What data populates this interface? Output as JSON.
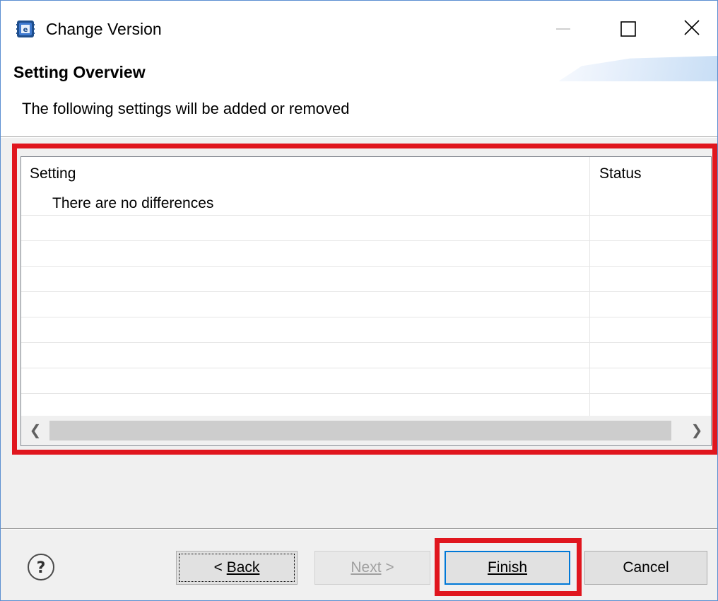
{
  "window": {
    "title": "Change Version",
    "icon": "eclipse-e2-icon"
  },
  "header": {
    "title": "Setting Overview",
    "description": "The following settings will be added or removed"
  },
  "table": {
    "columns": [
      "Setting",
      "Status"
    ],
    "rows": [
      {
        "setting": "There are no differences",
        "status": ""
      }
    ]
  },
  "footer": {
    "back_label": "Back",
    "back_prefix": "< ",
    "next_label": "Next",
    "next_suffix": " >",
    "finish_label": "Finish",
    "cancel_label": "Cancel"
  },
  "colors": {
    "highlight": "#e0161e",
    "focus_border": "#0078d7",
    "dialog_bg": "#f0f0f0"
  }
}
